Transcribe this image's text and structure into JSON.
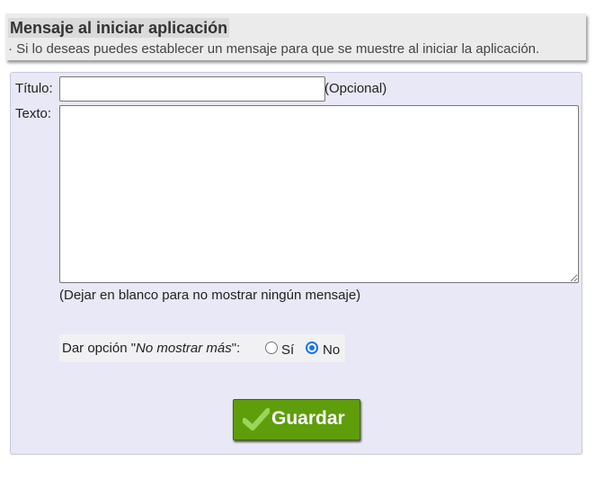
{
  "header": {
    "title": "Mensaje al iniciar aplicación",
    "subtitle": "· Si lo deseas puedes establecer un mensaje para que se muestre al iniciar la aplicación."
  },
  "form": {
    "titulo_label": "Título:",
    "titulo_value": "",
    "titulo_note": "(Opcional)",
    "texto_label": "Texto:",
    "texto_value": "",
    "hint": "(Dejar en blanco para no mostrar ningún mensaje)",
    "option_prefix": "Dar opción \"",
    "option_italic": "No mostrar más",
    "option_suffix": "\":",
    "option_si": "Sí",
    "option_no": "No",
    "option_selected": "No",
    "submit_label": "Guardar",
    "submit_icon": "checkmark-icon"
  },
  "colors": {
    "panel_bg": "#e8e8f6",
    "button_bg": "#5e9e0a",
    "radio_accent": "#1a73e8"
  }
}
